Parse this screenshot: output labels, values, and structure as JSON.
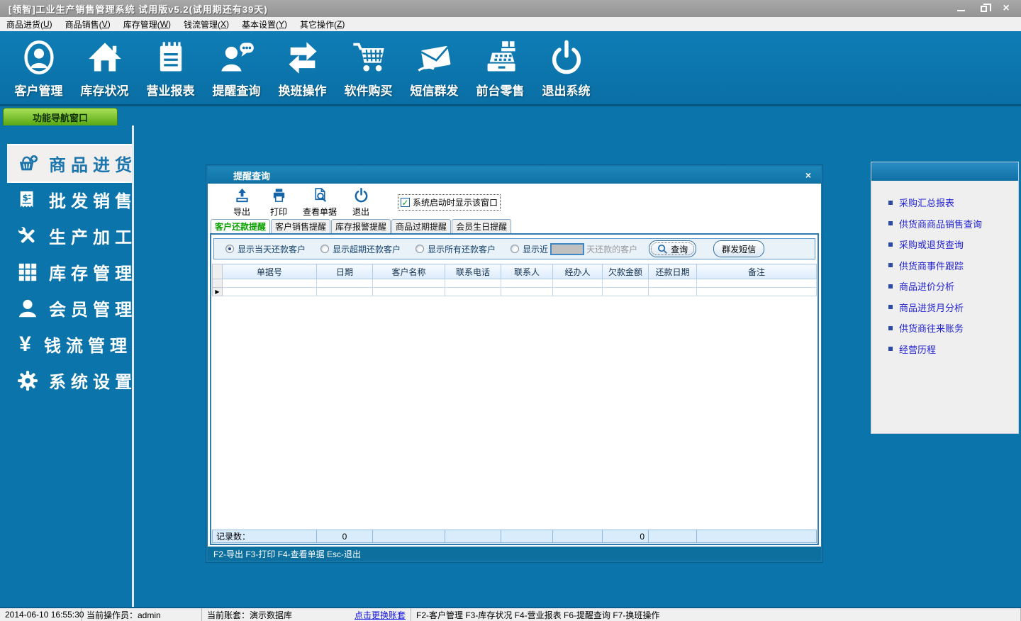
{
  "window": {
    "title": "[领智]工业生产销售管理系统  试用版v5.2(试用期还有39天)"
  },
  "glyphs": {
    "close": "×",
    "check": "✓",
    "row_indicator": "▶",
    "yen": "¥"
  },
  "menubar": {
    "items": [
      {
        "pre": "商品进货(",
        "key": "U",
        "post": ")"
      },
      {
        "pre": "商品销售(",
        "key": "V",
        "post": ")"
      },
      {
        "pre": "库存管理(",
        "key": "W",
        "post": ")"
      },
      {
        "pre": "钱流管理(",
        "key": "X",
        "post": ")"
      },
      {
        "pre": "基本设置(",
        "key": "Y",
        "post": ")"
      },
      {
        "pre": "其它操作(",
        "key": "Z",
        "post": ")"
      }
    ]
  },
  "toolbar": {
    "buttons": [
      {
        "label": "客户管理",
        "icon": "user-circle-icon"
      },
      {
        "label": "库存状况",
        "icon": "home-icon"
      },
      {
        "label": "营业报表",
        "icon": "notebook-icon"
      },
      {
        "label": "提醒查询",
        "icon": "person-chat-icon"
      },
      {
        "label": "换班操作",
        "icon": "swap-arrows-icon"
      },
      {
        "label": "软件购买",
        "icon": "cart-icon"
      },
      {
        "label": "短信群发",
        "icon": "envelope-icon"
      },
      {
        "label": "前台零售",
        "icon": "cash-register-icon"
      },
      {
        "label": "退出系统",
        "icon": "power-icon"
      }
    ]
  },
  "sidebar": {
    "tab_label": "功能导航窗口",
    "items": [
      {
        "label": "商品进货",
        "icon": "basket-icon",
        "active": true
      },
      {
        "label": "批发销售",
        "icon": "invoice-icon",
        "active": false
      },
      {
        "label": "生产加工",
        "icon": "tools-icon",
        "active": false
      },
      {
        "label": "库存管理",
        "icon": "grid-icon",
        "active": false
      },
      {
        "label": "会员管理",
        "icon": "member-icon",
        "active": false
      },
      {
        "label": "钱流管理",
        "icon": "yen-icon",
        "active": false
      },
      {
        "label": "系统设置",
        "icon": "gear-icon",
        "active": false
      }
    ]
  },
  "dialog": {
    "title": "提醒查询",
    "toolbar": {
      "buttons": [
        {
          "label": "导出",
          "icon": "export-icon"
        },
        {
          "label": "打印",
          "icon": "printer-icon"
        },
        {
          "label": "查看单据",
          "icon": "view-document-icon"
        },
        {
          "label": "退出",
          "icon": "exit-power-icon"
        }
      ],
      "checkbox": {
        "label": "系统启动时显示该窗口",
        "checked": true
      }
    },
    "tabs": [
      {
        "label": "客户还款提醒",
        "active": true
      },
      {
        "label": "客户销售提醒",
        "active": false
      },
      {
        "label": "库存报警提醒",
        "active": false
      },
      {
        "label": "商品过期提醒",
        "active": false
      },
      {
        "label": "会员生日提醒",
        "active": false
      }
    ],
    "filter": {
      "radios": [
        {
          "label": "显示当天还款客户",
          "selected": true
        },
        {
          "label": "显示超期还款客户",
          "selected": false
        },
        {
          "label": "显示所有还款客户",
          "selected": false
        },
        {
          "label": "显示近",
          "selected": false
        }
      ],
      "days_value": "",
      "days_suffix": "天还款的客户",
      "query_button": "查询",
      "sms_button": "群发短信"
    },
    "table": {
      "columns": [
        "",
        "单据号",
        "日期",
        "客户名称",
        "联系电话",
        "联系人",
        "经办人",
        "欠款金额",
        "还款日期",
        "备注"
      ],
      "summary": {
        "label": "记录数：",
        "date_count": "0",
        "amount_total": "0"
      }
    },
    "footer_hint": "F2-导出 F3-打印 F4-查看单据 Esc-退出"
  },
  "right_panel": {
    "links": [
      "采购汇总报表",
      "供货商商品销售查询",
      "采购或退货查询",
      "供货商事件跟踪",
      "商品进价分析",
      "商品进货月分析",
      "供货商往来账务",
      "经营历程"
    ]
  },
  "statusbar": {
    "time": "2014-06-10 16:55:30",
    "operator": "当前操作员：admin",
    "account": "当前账套：演示数据库",
    "switch_link": "点击更换账套",
    "hotkeys": "F2-客户管理 F3-库存状况 F4-营业报表 F6-提醒查询 F7-换班操作"
  }
}
